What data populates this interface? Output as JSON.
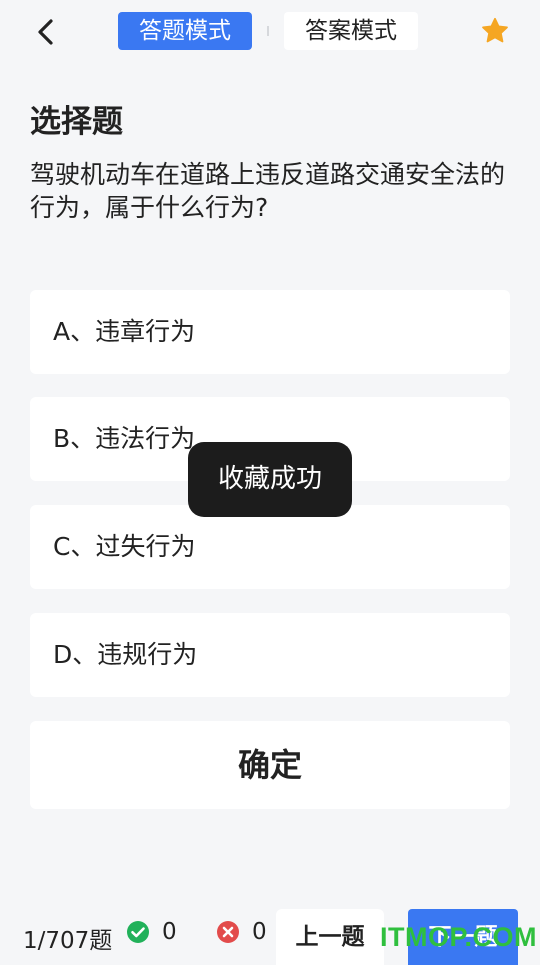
{
  "header": {
    "tabs": [
      {
        "label": "答题模式",
        "active": true
      },
      {
        "label": "答案模式",
        "active": false
      }
    ],
    "icons": {
      "back": "chevron-left-icon",
      "favorite": "star-icon"
    },
    "colors": {
      "accent": "#3a78f2",
      "star": "#f5a623"
    }
  },
  "question": {
    "type": "选择题",
    "text": "驾驶机动车在道路上违反道路交通安全法的行为，属于什么行为?",
    "options": [
      {
        "label": "A、违章行为"
      },
      {
        "label": "B、违法行为"
      },
      {
        "label": "C、过失行为"
      },
      {
        "label": "D、违规行为"
      }
    ],
    "confirm_label": "确定"
  },
  "toast": {
    "message": "收藏成功"
  },
  "footer": {
    "progress": "1/707题",
    "correct_count": "0",
    "wrong_count": "0",
    "prev_label": "上一题",
    "next_label": "下一题",
    "colors": {
      "correct": "#21b15a",
      "wrong": "#e24b4b"
    }
  },
  "watermark": {
    "text": "ITMOP.COM"
  }
}
